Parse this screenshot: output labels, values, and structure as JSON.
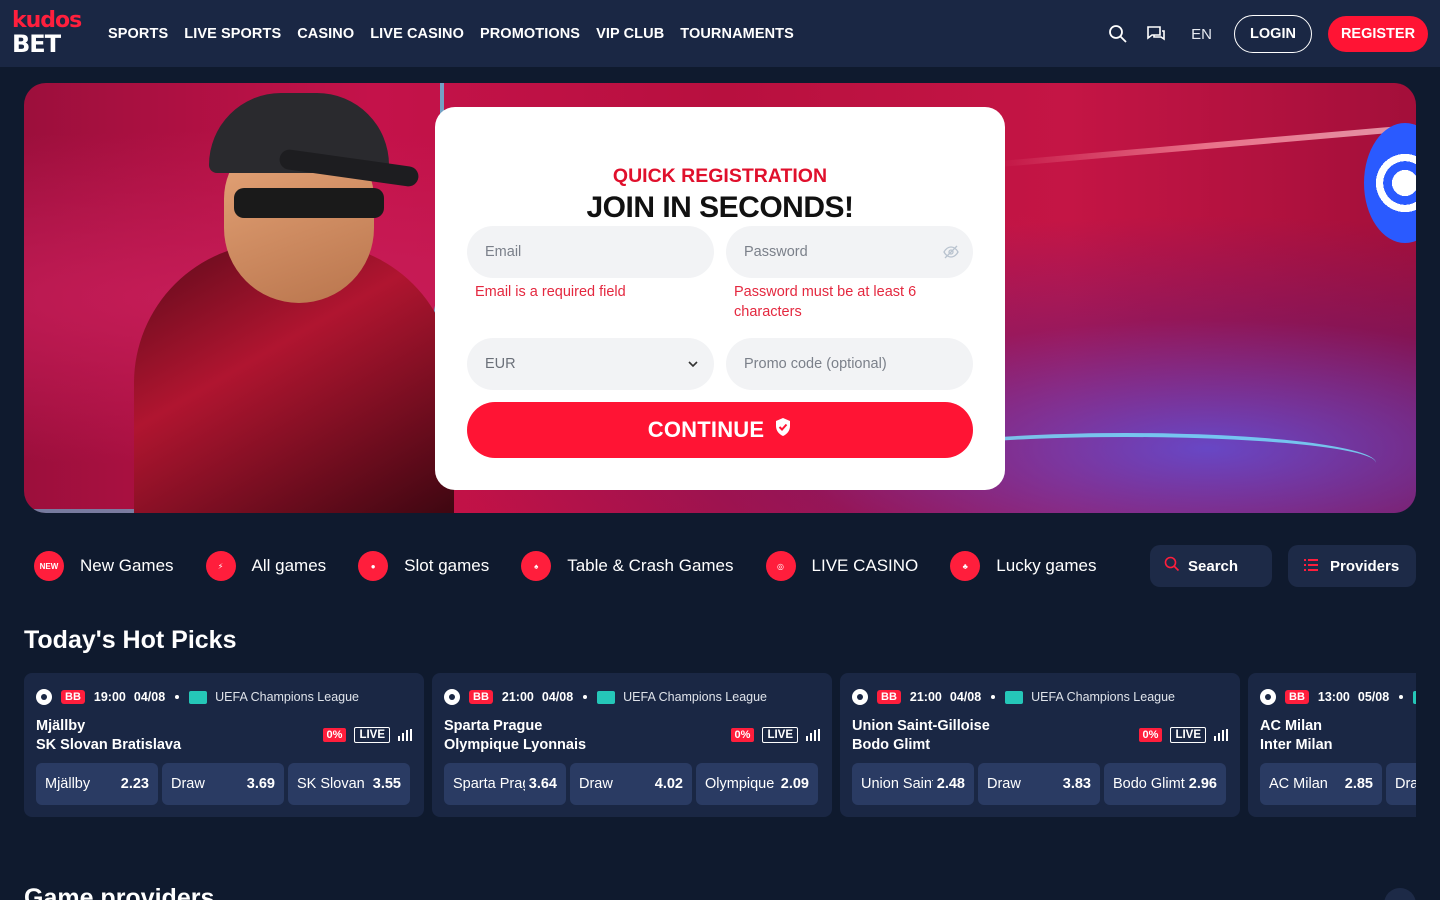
{
  "brand": {
    "logo_top": "kudos",
    "logo_bottom": "BET"
  },
  "nav": {
    "items": [
      {
        "label": "SPORTS"
      },
      {
        "label": "LIVE SPORTS"
      },
      {
        "label": "CASINO"
      },
      {
        "label": "LIVE CASINO"
      },
      {
        "label": "PROMOTIONS"
      },
      {
        "label": "VIP CLUB"
      },
      {
        "label": "TOURNAMENTS"
      }
    ]
  },
  "header": {
    "language": "EN",
    "login_label": "LOGIN",
    "register_label": "REGISTER"
  },
  "registration": {
    "subtitle": "QUICK REGISTRATION",
    "title": "JOIN IN SECONDS!",
    "email_placeholder": "Email",
    "email_error": "Email is a required field",
    "password_placeholder": "Password",
    "password_error": "Password must be at least 6 characters",
    "currency_value": "EUR",
    "promo_placeholder": "Promo code (optional)",
    "continue_label": "CONTINUE"
  },
  "categories": [
    {
      "label": "New Games",
      "icon": "new-badge-icon",
      "icon_text": "NEW"
    },
    {
      "label": "All games",
      "icon": "cards-lightning-icon",
      "icon_text": ""
    },
    {
      "label": "Slot games",
      "icon": "cherry-icon",
      "icon_text": ""
    },
    {
      "label": "Table & Crash Games",
      "icon": "playing-cards-icon",
      "icon_text": ""
    },
    {
      "label": "LIVE CASINO",
      "icon": "roulette-icon",
      "icon_text": ""
    },
    {
      "label": "Lucky games",
      "icon": "clover-icon",
      "icon_text": ""
    }
  ],
  "tools": {
    "search_label": "Search",
    "providers_label": "Providers"
  },
  "hot_picks": {
    "title": "Today's Hot Picks",
    "matches": [
      {
        "badge": "BB",
        "time": "19:00",
        "date": "04/08",
        "league": "UEFA Champions League",
        "home": "Mjällby",
        "away": "SK Slovan Bratislava",
        "pct": "0%",
        "live": "LIVE",
        "odds": [
          {
            "name": "Mjällby",
            "value": "2.23"
          },
          {
            "name": "Draw",
            "value": "3.69"
          },
          {
            "name": "SK Slovan Bratislava",
            "value": "3.55"
          }
        ]
      },
      {
        "badge": "BB",
        "time": "21:00",
        "date": "04/08",
        "league": "UEFA Champions League",
        "home": "Sparta Prague",
        "away": "Olympique Lyonnais",
        "pct": "0%",
        "live": "LIVE",
        "odds": [
          {
            "name": "Sparta Prague",
            "value": "3.64"
          },
          {
            "name": "Draw",
            "value": "4.02"
          },
          {
            "name": "Olympique Lyonnais",
            "value": "2.09"
          }
        ]
      },
      {
        "badge": "BB",
        "time": "21:00",
        "date": "04/08",
        "league": "UEFA Champions League",
        "home": "Union Saint-Gilloise",
        "away": "Bodo Glimt",
        "pct": "0%",
        "live": "LIVE",
        "odds": [
          {
            "name": "Union Saint-Gilloise",
            "value": "2.48"
          },
          {
            "name": "Draw",
            "value": "3.83"
          },
          {
            "name": "Bodo Glimt",
            "value": "2.96"
          }
        ]
      },
      {
        "badge": "BB",
        "time": "13:00",
        "date": "05/08",
        "league": "",
        "home": "AC Milan",
        "away": "Inter Milan",
        "pct": "",
        "live": "",
        "odds": [
          {
            "name": "AC Milan",
            "value": "2.85"
          },
          {
            "name": "Draw",
            "value": ""
          },
          {
            "name": "",
            "value": ""
          }
        ]
      }
    ]
  },
  "providers_section": {
    "title": "Game providers"
  },
  "colors": {
    "accent": "#ff1434",
    "header_bg": "#1a2744",
    "page_bg": "#0f1a2e",
    "card_bg": "#1a2744",
    "odd_bg": "#2a3b63"
  }
}
